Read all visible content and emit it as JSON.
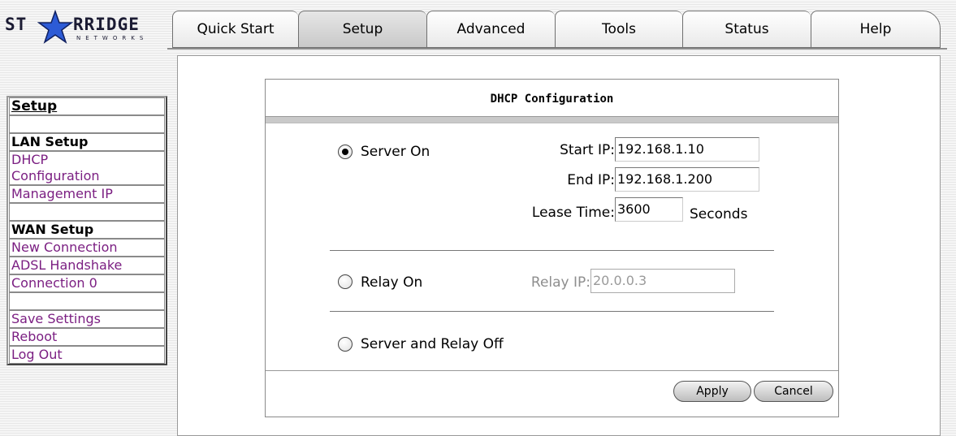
{
  "logo": {
    "left_text": "ST",
    "right_text": "RRIDGE",
    "sub_text": "NETWORKS"
  },
  "tabs": [
    {
      "label": "Quick Start",
      "active": false
    },
    {
      "label": "Setup",
      "active": true
    },
    {
      "label": "Advanced",
      "active": false
    },
    {
      "label": "Tools",
      "active": false
    },
    {
      "label": "Status",
      "active": false
    },
    {
      "label": "Help",
      "active": false
    }
  ],
  "sidebar": {
    "title": "Setup",
    "lan_heading": "LAN Setup",
    "dhcp_line1": "DHCP",
    "dhcp_line2": "Configuration",
    "management_ip": "Management IP",
    "wan_heading": "WAN Setup",
    "new_connection": "New Connection",
    "adsl_handshake": "ADSL Handshake",
    "connection_0": "Connection 0",
    "save_settings": "Save Settings",
    "reboot": "Reboot",
    "log_out": "Log Out"
  },
  "dialog": {
    "title": "DHCP Configuration",
    "server_on": {
      "label": "Server On",
      "selected": true,
      "start_ip_label": "Start IP:",
      "start_ip": "192.168.1.10",
      "end_ip_label": "End IP:",
      "end_ip": "192.168.1.200",
      "lease_time_label": "Lease Time:",
      "lease_time": "3600",
      "lease_unit": "Seconds"
    },
    "relay_on": {
      "label": "Relay On",
      "selected": false,
      "relay_ip_label": "Relay IP:",
      "relay_ip": "20.0.0.3"
    },
    "off": {
      "label": "Server and Relay Off",
      "selected": false
    },
    "apply": "Apply",
    "cancel": "Cancel"
  }
}
